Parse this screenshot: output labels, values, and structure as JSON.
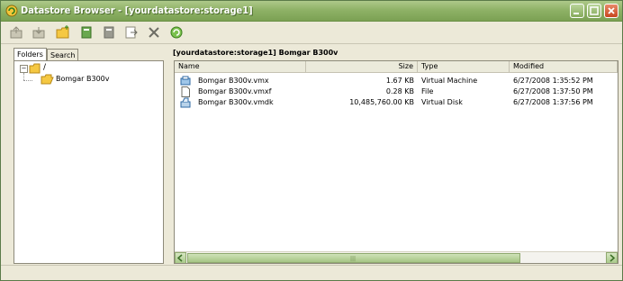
{
  "window": {
    "title": "Datastore Browser - [yourdatastore:storage1]"
  },
  "toolbar": {
    "buttons": [
      {
        "name": "upload-files-button",
        "icon": "upload-icon"
      },
      {
        "name": "download-button",
        "icon": "download-icon"
      },
      {
        "name": "new-folder-button",
        "icon": "new-folder-icon"
      },
      {
        "name": "add-to-inventory-button",
        "icon": "add-inventory-icon"
      },
      {
        "name": "remove-button",
        "icon": "remove-icon"
      },
      {
        "name": "move-button",
        "icon": "move-icon"
      },
      {
        "name": "delete-button",
        "icon": "delete-icon"
      },
      {
        "name": "refresh-button",
        "icon": "refresh-icon"
      }
    ]
  },
  "tabs": {
    "folders": "Folders",
    "search": "Search"
  },
  "tree": {
    "root": "/",
    "child": "Bomgar B300v"
  },
  "path": "[yourdatastore:storage1] Bomgar B300v",
  "table": {
    "columns": [
      "Name",
      "Size",
      "Type",
      "Modified"
    ],
    "rows": [
      {
        "name": "Bomgar B300v.vmx",
        "size": "1.67 KB",
        "type": "Virtual Machine",
        "modified": "6/27/2008 1:35:52 PM",
        "icon": "vm-icon"
      },
      {
        "name": "Bomgar B300v.vmxf",
        "size": "0.28 KB",
        "type": "File",
        "modified": "6/27/2008 1:37:50 PM",
        "icon": "file-icon"
      },
      {
        "name": "Bomgar B300v.vmdk",
        "size": "10,485,760.00 KB",
        "type": "Virtual Disk",
        "modified": "6/27/2008 1:37:56 PM",
        "icon": "disk-icon"
      }
    ]
  },
  "colors": {
    "titlebar": "#8fb267",
    "chrome": "#ece9d8"
  }
}
